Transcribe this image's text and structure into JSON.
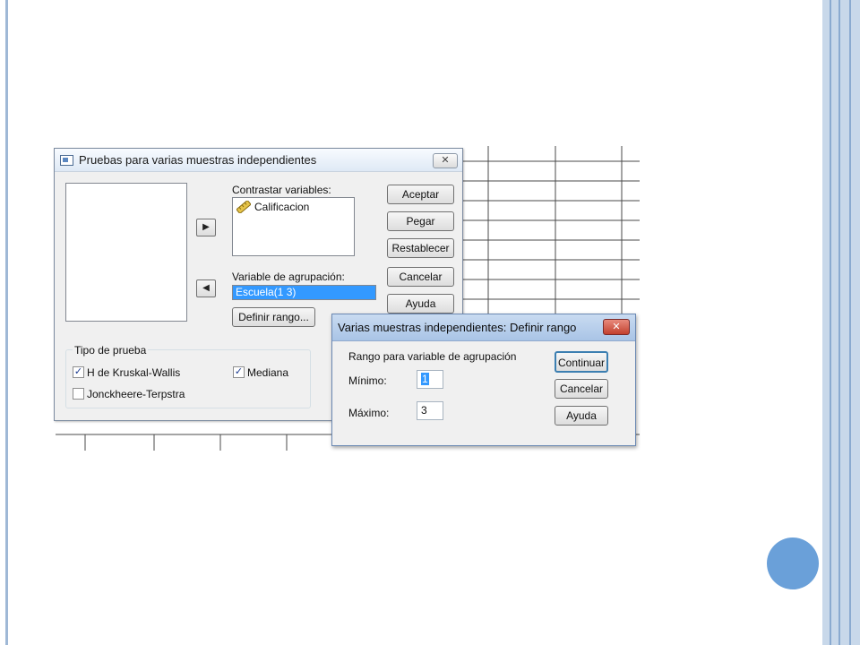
{
  "dialog_main": {
    "title": "Pruebas para varias muestras independientes",
    "contrast_label": "Contrastar variables:",
    "contrast_items": [
      "Calificacion"
    ],
    "grouping_label": "Variable de agrupación:",
    "grouping_value": "Escuela(1 3)",
    "define_range_button": "Definir rango...",
    "buttons": {
      "accept": "Aceptar",
      "paste": "Pegar",
      "reset": "Restablecer",
      "cancel": "Cancelar",
      "help": "Ayuda"
    },
    "test_type": {
      "legend": "Tipo de prueba",
      "kruskal": {
        "label": "H de Kruskal-Wallis",
        "checked": true
      },
      "median": {
        "label": "Mediana",
        "checked": true
      },
      "jonckheere": {
        "label": "Jonckheere-Terpstra",
        "checked": false
      }
    },
    "icons": {
      "close": "close-icon",
      "move_right": "arrow-right-icon",
      "move_left": "arrow-left-icon",
      "variable": "ruler-icon"
    }
  },
  "dialog_range": {
    "title": "Varias muestras independientes: Definir rango",
    "section_label": "Rango para variable de agrupación",
    "min_label": "Mínimo:",
    "min_value": "1",
    "max_label": "Máximo:",
    "max_value": "3",
    "buttons": {
      "continue": "Continuar",
      "cancel": "Cancelar",
      "help": "Ayuda"
    }
  },
  "colors": {
    "accent_circle": "#6aa0d9",
    "selection": "#3399ff",
    "frame": "#c8d8ea"
  }
}
